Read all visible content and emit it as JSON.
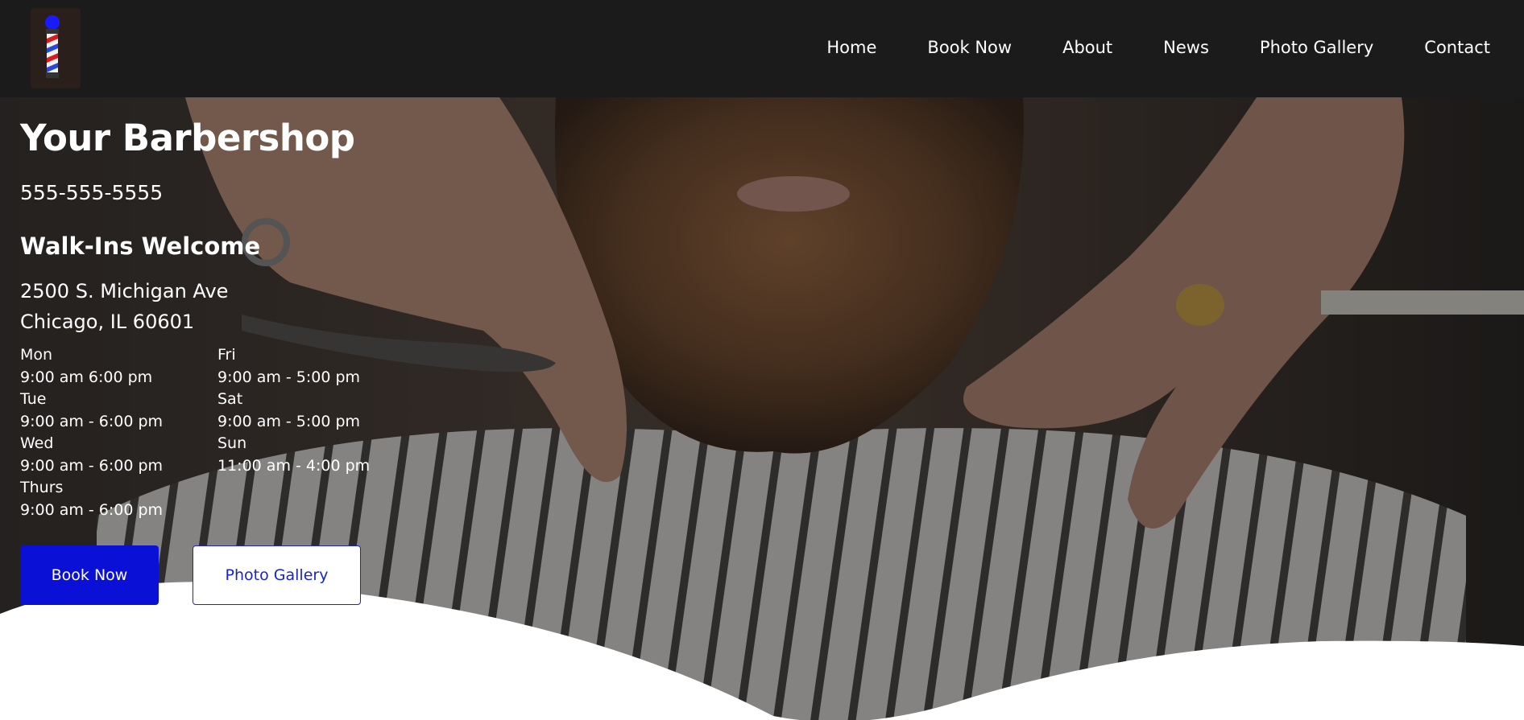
{
  "nav": {
    "logo_icon": "barber-pole-icon",
    "links": [
      "Home",
      "Book Now",
      "About",
      "News",
      "Photo Gallery",
      "Contact"
    ]
  },
  "hero": {
    "title": "Your Barbershop",
    "phone": "555-555-5555",
    "walkins": "Walk-Ins Welcome",
    "address_line1": "2500 S. Michigan Ave",
    "address_line2": "Chicago, IL 60601",
    "hours": [
      {
        "day": "Mon",
        "time": "9:00 am 6:00 pm"
      },
      {
        "day": "Fri",
        "time": "9:00 am - 5:00 pm"
      },
      {
        "day": "Tue",
        "time": "9:00 am - 6:00 pm"
      },
      {
        "day": "Sat",
        "time": "9:00 am - 5:00 pm"
      },
      {
        "day": "Wed",
        "time": "9:00 am - 6:00 pm"
      },
      {
        "day": "Sun",
        "time": "11:00 am - 4:00 pm"
      },
      {
        "day": "Thurs",
        "time": "9:00 am - 6:00 pm"
      }
    ],
    "buttons": {
      "book_now": "Book Now",
      "photo_gallery": "Photo Gallery"
    },
    "background_image": "barber-trimming-beard-photo"
  },
  "colors": {
    "navbar": "#1b1b1b",
    "primary_button": "#0b10d6",
    "outline_button_text": "#1a25c4",
    "text": "#ffffff"
  }
}
